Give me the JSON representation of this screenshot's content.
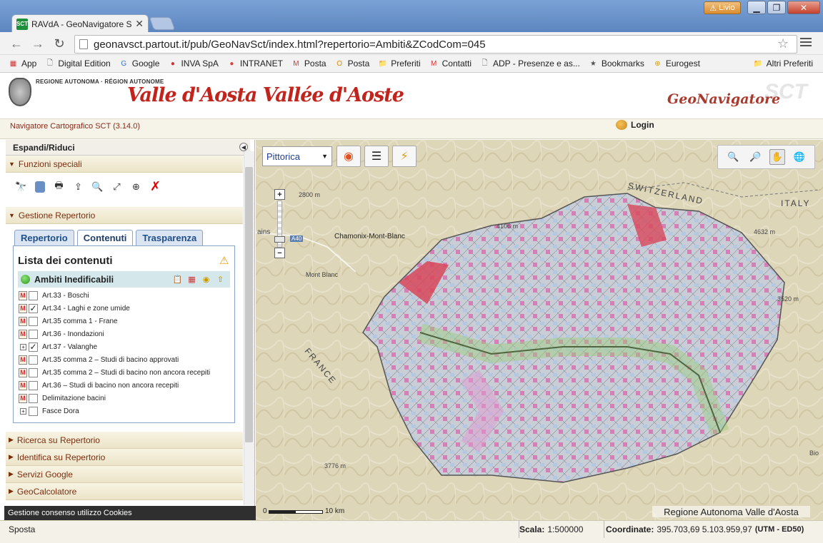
{
  "browser": {
    "tab_title": "RAVdA - GeoNavigatore S",
    "tab_favicon": "SCT",
    "user_badge": "Livio",
    "url": "geonavsct.partout.it/pub/GeoNavSct/index.html?repertorio=Ambiti&ZCodCom=045",
    "bookmarks": [
      {
        "label": "App",
        "icon": "apps-grid-icon"
      },
      {
        "label": "Digital Edition",
        "icon": "page-icon"
      },
      {
        "label": "Google",
        "icon": "google-icon"
      },
      {
        "label": "INVA SpA",
        "icon": "inva-icon"
      },
      {
        "label": "INTRANET",
        "icon": "intranet-icon"
      },
      {
        "label": "Posta",
        "icon": "gmail-icon"
      },
      {
        "label": "Posta",
        "icon": "outlook-icon"
      },
      {
        "label": "Preferiti",
        "icon": "folder-icon"
      },
      {
        "label": "Contatti",
        "icon": "gmail-icon"
      },
      {
        "label": "ADP - Presenze e as...",
        "icon": "page-icon"
      },
      {
        "label": "Bookmarks",
        "icon": "star-icon"
      },
      {
        "label": "Eurogest",
        "icon": "eurogest-icon"
      }
    ],
    "other_bookmarks": "Altri Preferiti"
  },
  "header": {
    "region_small": "REGIONE AUTONOMA · RÉGION AUTONOME",
    "region_big": "Valle d'Aosta Vallée d'Aoste",
    "app_name": "GeoNavigatore",
    "app_watermark": "SCT",
    "version": "Navigatore Cartografico SCT (3.14.0)",
    "login": "Login"
  },
  "sidebar": {
    "expand_title": "Espandi/Riduci",
    "funzioni_speciali": "Funzioni speciali",
    "gestione_repertorio": "Gestione Repertorio",
    "tools": [
      "binoculars-icon",
      "document-icon",
      "print-icon",
      "export-icon",
      "preview-icon",
      "resize-icon",
      "crosshair-icon",
      "clear-icon"
    ],
    "tabs": [
      {
        "label": "Repertorio",
        "active": false
      },
      {
        "label": "Contenuti",
        "active": true
      },
      {
        "label": "Trasparenza",
        "active": false
      }
    ],
    "content_title": "Lista dei contenuti",
    "group_name": "Ambiti Inedificabili",
    "layers": [
      {
        "label": "Art.33 - Boschi",
        "checked": false,
        "type": "m"
      },
      {
        "label": "Art.34 - Laghi e zone umide",
        "checked": true,
        "type": "m"
      },
      {
        "label": "Art.35 comma 1 - Frane",
        "checked": false,
        "type": "m"
      },
      {
        "label": "Art.36 - Inondazioni",
        "checked": false,
        "type": "m"
      },
      {
        "label": "Art.37 - Valanghe",
        "checked": true,
        "type": "plus"
      },
      {
        "label": "Art.35 comma 2 – Studi di bacino approvati",
        "checked": false,
        "type": "m"
      },
      {
        "label": "Art.35 comma 2 – Studi di bacino non ancora recepiti",
        "checked": false,
        "type": "m"
      },
      {
        "label": "Art.36 – Studi di bacino non ancora recepiti",
        "checked": false,
        "type": "m"
      },
      {
        "label": "Delimitazione bacini",
        "checked": false,
        "type": "m"
      },
      {
        "label": "Fasce Dora",
        "checked": false,
        "type": "plus"
      }
    ],
    "sections": [
      "Ricerca su Repertorio",
      "Identifica su Repertorio",
      "Servizi Google",
      "GeoCalcolatore"
    ],
    "cookies": "Gestione consenso utilizzo Cookies"
  },
  "map": {
    "basemap_select": "Pittorica",
    "scale_zero": "0",
    "scale_label": "10 km",
    "copyright": "Regione Autonoma Valle d'Aosta",
    "labels": [
      "SWITZERLAND",
      "ITALY",
      "Chamonix-Mont-Blanc",
      "FRANCE",
      "Mont Blanc",
      "Bio",
      "2800 m",
      "4106 m",
      "4632 m",
      "3520 m",
      "3776 m",
      "A40",
      "ains"
    ]
  },
  "status": {
    "mode": "Sposta",
    "scale_label": "Scala:",
    "scale_value": "1:500000",
    "coord_label": "Coordinate:",
    "coord_value": "395.703,69 5.103.959,97",
    "coord_system": "(UTM - ED50)"
  }
}
